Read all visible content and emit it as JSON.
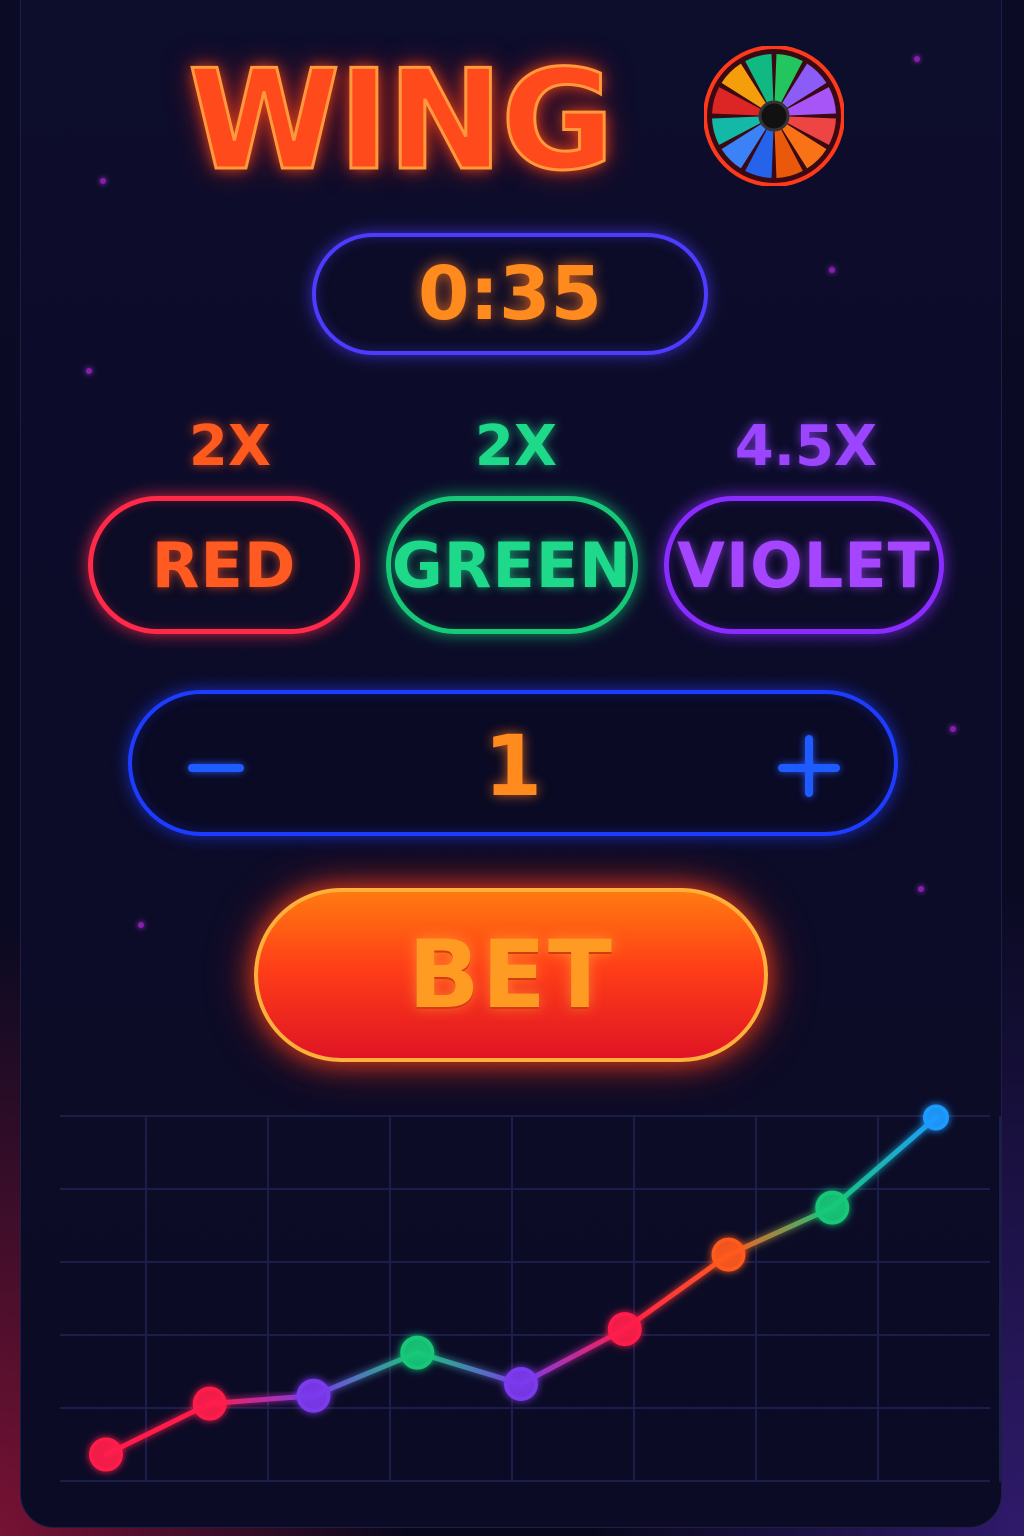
{
  "header": {
    "title": "WING",
    "wheel_colors": [
      "#22c55e",
      "#8b5cf6",
      "#a855f7",
      "#ef4444",
      "#f97316",
      "#ea580c",
      "#2563eb",
      "#3b82f6",
      "#14b8a6",
      "#dc2626",
      "#f59e0b",
      "#10b981"
    ]
  },
  "timer": {
    "value": "0:35"
  },
  "bets": [
    {
      "multiplier": "2X",
      "label": "RED",
      "color": "#ff2a4a",
      "text_color": "#ff5a22"
    },
    {
      "multiplier": "2X",
      "label": "GREEN",
      "color": "#16c878",
      "text_color": "#1fd98a"
    },
    {
      "multiplier": "4.5X",
      "label": "VIOLET",
      "color": "#8a2cff",
      "text_color": "#a545ff"
    }
  ],
  "stepper": {
    "value": "1"
  },
  "bet_button": {
    "label": "BET"
  },
  "chart_data": {
    "type": "line",
    "grid": true,
    "ylim": [
      0,
      10
    ],
    "x": [
      1,
      2,
      3,
      4,
      5,
      6,
      7,
      8,
      9
    ],
    "points": [
      {
        "x": 1,
        "y": 0.7,
        "color": "#ff1f4b"
      },
      {
        "x": 2,
        "y": 2.0,
        "color": "#ff1f4b"
      },
      {
        "x": 3,
        "y": 2.2,
        "color": "#7c3aed"
      },
      {
        "x": 4,
        "y": 3.3,
        "color": "#16c878"
      },
      {
        "x": 5,
        "y": 2.5,
        "color": "#7c3aed"
      },
      {
        "x": 6,
        "y": 3.9,
        "color": "#ff1f4b"
      },
      {
        "x": 7,
        "y": 5.8,
        "color": "#ff5a1e"
      },
      {
        "x": 8,
        "y": 7.0,
        "color": "#16c878"
      },
      {
        "x": 9,
        "y": 9.3,
        "color": "#1e9bff"
      }
    ]
  }
}
